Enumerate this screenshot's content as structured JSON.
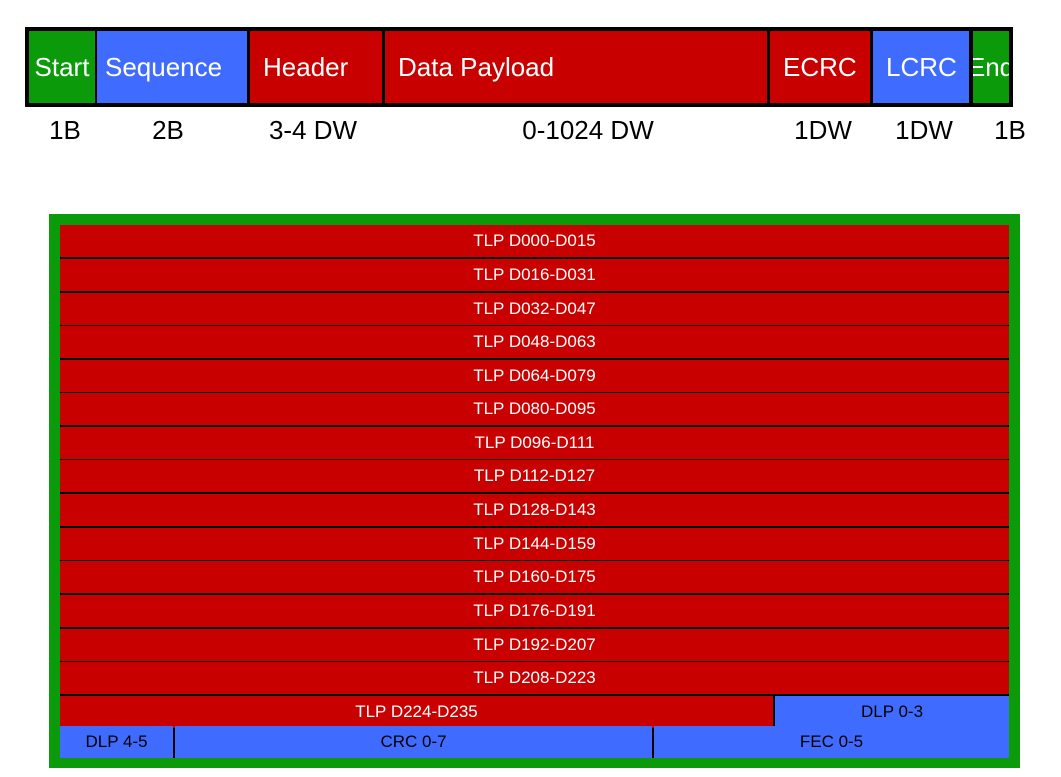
{
  "colors": {
    "red": "#c80000",
    "blue": "#3f6bff",
    "green": "#0a9a0a",
    "border": "#000000"
  },
  "packet": {
    "segments": [
      {
        "label": "Start",
        "color": "green"
      },
      {
        "label": "Sequence",
        "color": "blue"
      },
      {
        "label": "Header",
        "color": "red"
      },
      {
        "label": "Data Payload",
        "color": "red"
      },
      {
        "label": "ECRC",
        "color": "red"
      },
      {
        "label": "LCRC",
        "color": "blue"
      },
      {
        "label": "End",
        "color": "green"
      }
    ],
    "sizes": [
      "1B",
      "2B",
      "3-4 DW",
      "0-1024 DW",
      "1DW",
      "1DW",
      "1B"
    ]
  },
  "flit": {
    "rows": [
      [
        "TLP D000-D015"
      ],
      [
        "TLP D016-D031"
      ],
      [
        "TLP D032-D047"
      ],
      [
        "TLP D048-D063"
      ],
      [
        "TLP D064-D079"
      ],
      [
        "TLP D080-D095"
      ],
      [
        "TLP D096-D111"
      ],
      [
        "TLP D112-D127"
      ],
      [
        "TLP D128-D143"
      ],
      [
        "TLP D144-D159"
      ],
      [
        "TLP D160-D175"
      ],
      [
        "TLP D176-D191"
      ],
      [
        "TLP D192-D207"
      ],
      [
        "TLP D208-D223"
      ],
      [
        "TLP D224-D235",
        "DLP 0-3"
      ],
      [
        "DLP 4-5",
        "CRC 0-7",
        "FEC 0-5"
      ]
    ]
  }
}
